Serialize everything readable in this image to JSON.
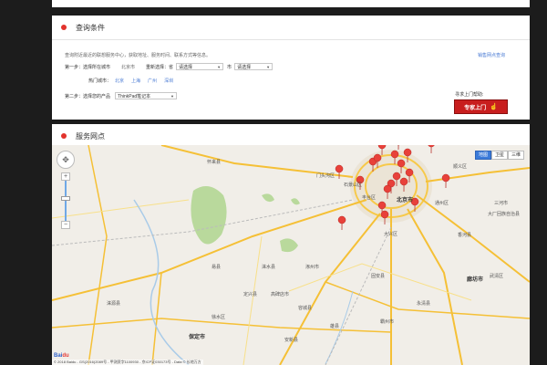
{
  "query": {
    "title": "查询条件",
    "desc": "查询附近最近的联想服务中心，获取地址、服务时间、联系方式等信息。",
    "step1_label": "第一步：选择所在城市",
    "current_city": "北京市",
    "reselect_label": "重新选择：省",
    "province_value": "请选择",
    "city_label": "市",
    "city_value": "请选择",
    "hot_label": "热门城市：",
    "hot_cities": [
      "北京",
      "上海",
      "广州",
      "深圳"
    ],
    "step2_label": "第二步：选择您的产品",
    "product_value": "ThinkPad笔记本",
    "network_link": "销售网点查询",
    "help_text": "寻求上门帮助:",
    "visit_button": "专家上门"
  },
  "service": {
    "title": "服务网点"
  },
  "map": {
    "labels": [
      "北京市",
      "石景山区",
      "丰台区",
      "大兴区",
      "涿州市",
      "廊坊市",
      "保定市",
      "固安县",
      "永清县",
      "霸州市",
      "涞水县",
      "易县",
      "怀来县",
      "门头沟区",
      "顺义区",
      "通州区",
      "三河市",
      "大厂回族自治县",
      "香河县",
      "高碑店市",
      "定兴县",
      "徐水区",
      "涞源县",
      "雄县",
      "容城县",
      "安新县",
      "武清区"
    ],
    "map_type": [
      "地图",
      "卫星",
      "三维"
    ],
    "copyright": "© 2018 Baidu - GS(2016)2089号 - 甲测资字1100930 - 京ICP证030173号 - Data © 长地万方",
    "logo": "Bai",
    "logo_suffix": "du"
  }
}
